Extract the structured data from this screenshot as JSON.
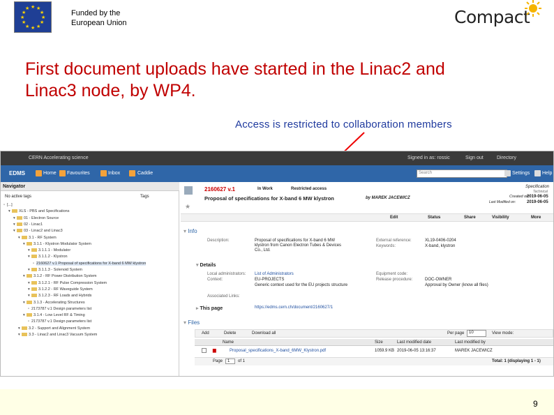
{
  "slide": {
    "funded_line1": "Funded by the",
    "funded_line2": "European Union",
    "logo": "Compact",
    "headline_line1": "First document uploads have started in the Linac2 and",
    "headline_line2": "Linac3 node, by WP4.",
    "note": "Access is restricted to collaboration members",
    "page_number": "9"
  },
  "edms": {
    "topbar": {
      "brand": "CERN  Accelerating science",
      "signed": "Signed in as:  rossic",
      "signout": "Sign out",
      "directory": "Directory"
    },
    "nav": {
      "logo": "EDMS",
      "home": "Home",
      "favourites": "Favourites",
      "inbox": "Inbox",
      "caddie": "Caddie",
      "search_placeholder": "Search",
      "settings": "Settings",
      "help": "Help"
    },
    "navigator": {
      "title": "Navigator",
      "no_tags": "No active tags",
      "tags": "Tags",
      "tree": [
        "[...]",
        "XLS - PBS and Specifications",
        "01 - Electron Source",
        "02 - Linac1",
        "03 - Linac2 and Linac3",
        "3.1 - RF System",
        "3.1.1 - Klystron Modulator System",
        "3.1.1.1 - Modulator",
        "3.1.1.2 - Klystron",
        "2160627 v.1 Proposal of specifications for X-band 6 MW klystron",
        "3.1.1.3 - Solenoid System",
        "3.1.2 - RF Power Distribution System",
        "3.1.2.1 - RF Pulse Compression System",
        "3.1.2.2 - RF Waveguide System",
        "3.1.2.3 - RF Loads and Hybrids",
        "3.1.3 - Accelerating Structures",
        "2173787 v.1 Design parameters list",
        "3.1.4 - Low Level RF & Timing",
        "2173787 v.1 Design parameters list",
        "3.2 - Support and Alignment System",
        "3.3 - Linac2 and Linac3 Vacuum System"
      ]
    },
    "doc": {
      "id": "2160627 v.1",
      "status": "In Work",
      "access": "Restricted access",
      "title": "Proposal of specifications for X-band 6 MW klystron",
      "author": "by MAREK JACEWICZ",
      "type": "Specification",
      "type_sub": "Technical",
      "created_label": "Created on:",
      "created": "2019-06-05",
      "modified_label": "Last Modified on:",
      "modified": "2019-06-05",
      "actions": [
        "Edit",
        "Status",
        "Share",
        "Visibility",
        "More"
      ],
      "info_heading": "Info",
      "desc_label": "Description:",
      "desc": "Proposal of specifications for X-band 6 MW klystron from Canon Electron Tubes & Devices Co., Ltd.",
      "extref_label": "External reference:",
      "extref": "XL19-0406-0204",
      "keywords_label": "Keywords:",
      "keywords": "X-band, klystron",
      "details_heading": "Details",
      "localadmin_label": "Local administrators:",
      "localadmin": "List of Administrators",
      "context_label": "Context:",
      "context": "EU-PROJECTS",
      "context_desc": "Generic context used for the EU projects structure",
      "eqcode_label": "Equipment code:",
      "eqcode": "",
      "release_label": "Release procedure:",
      "release": "DOC-OWNER",
      "release_desc": "Approval by Owner (know all files)",
      "assoclinks_label": "Associated Links:",
      "thispage_label": "This page",
      "thispage": "https://edms.cern.ch/document/2160627/1",
      "files_heading": "Files",
      "file_actions": [
        "Add",
        "Delete",
        "Download all"
      ],
      "perpage_label": "Per page",
      "perpage": "10",
      "viewmode_label": "View mode:",
      "columns": [
        "Name",
        "Size",
        "Last modified date",
        "Last modified by"
      ],
      "file": {
        "name": "Proposal_specifications_X-band_6MW_Klystron.pdf",
        "size": "1059.9 KB",
        "date": "2019-06-05 13:16:37",
        "by": "MAREK JACEWICZ"
      },
      "page_label": "Page",
      "page": "1",
      "of": "of 1",
      "total": "Total: 1 (displaying 1 - 1)"
    }
  }
}
